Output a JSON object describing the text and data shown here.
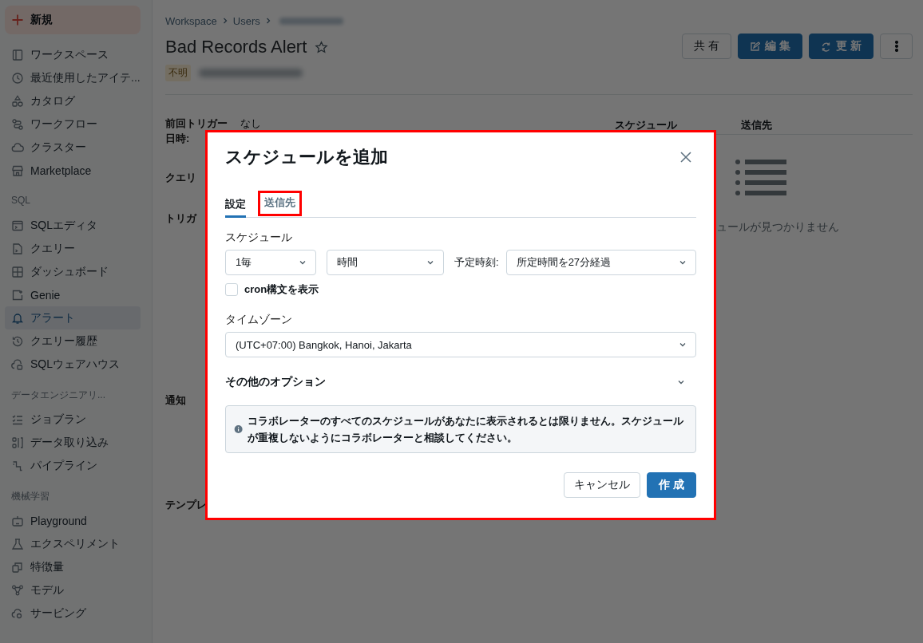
{
  "sidebar": {
    "new_button": {
      "label": "新規"
    },
    "sections": [
      {
        "items": [
          {
            "label": "ワークスペース",
            "selected": false
          },
          {
            "label": "最近使用したアイテ...",
            "selected": false
          },
          {
            "label": "カタログ",
            "selected": false
          },
          {
            "label": "ワークフロー",
            "selected": false
          },
          {
            "label": "クラスター",
            "selected": false
          },
          {
            "label": "Marketplace",
            "selected": false
          }
        ]
      },
      {
        "heading": "SQL",
        "items": [
          {
            "label": "SQLエディタ",
            "selected": false
          },
          {
            "label": "クエリー",
            "selected": false
          },
          {
            "label": "ダッシュボード",
            "selected": false
          },
          {
            "label": "Genie",
            "selected": false
          },
          {
            "label": "アラート",
            "selected": true
          },
          {
            "label": "クエリー履歴",
            "selected": false
          },
          {
            "label": "SQLウェアハウス",
            "selected": false
          }
        ]
      },
      {
        "heading": "データエンジニアリ...",
        "items": [
          {
            "label": "ジョブラン",
            "selected": false
          },
          {
            "label": "データ取り込み",
            "selected": false
          },
          {
            "label": "パイプライン",
            "selected": false
          }
        ]
      },
      {
        "heading": "機械学習",
        "items": [
          {
            "label": "Playground",
            "selected": false
          },
          {
            "label": "エクスペリメント",
            "selected": false
          },
          {
            "label": "特徴量",
            "selected": false
          },
          {
            "label": "モデル",
            "selected": false
          },
          {
            "label": "サービング",
            "selected": false
          }
        ]
      }
    ]
  },
  "page": {
    "breadcrumb": [
      "Workspace",
      "Users"
    ],
    "title": "Bad Records Alert",
    "favorite": false,
    "status_badge": "不明",
    "actions": [
      {
        "label": "共有",
        "kind": "default"
      },
      {
        "label": "編集",
        "kind": "primary"
      },
      {
        "label": "更新",
        "kind": "primary"
      }
    ],
    "last_triggered": {
      "label": "前回トリガー日時:",
      "value": "なし"
    },
    "fields": [
      "クエリ",
      "トリガ",
      "通知",
      "テンプレ"
    ],
    "right_panel": {
      "columns": [
        "スケジュール",
        "送信先"
      ],
      "empty_text": "ュールが見つかりません"
    }
  },
  "dialog": {
    "title": "スケジュールを追加",
    "highlighted": true,
    "tabs": [
      {
        "label": "設定",
        "selected": true,
        "highlighted": false
      },
      {
        "label": "送信先",
        "selected": false,
        "highlighted": true
      }
    ],
    "schedule_label": "スケジュール",
    "interval": "1毎",
    "unit": "時間",
    "time_label": "予定時刻:",
    "time": "所定時間を27分経過",
    "cron_checkbox": {
      "label": "cron構文を表示",
      "checked": false
    },
    "timezone_label": "タイムゾーン",
    "timezone": "(UTC+07:00) Bangkok, Hanoi, Jakarta",
    "more_options": {
      "label": "その他のオプション",
      "expanded": false
    },
    "info": "コラボレーターのすべてのスケジュールがあなたに表示されるとは限りません。スケジュールが重複しないようにコラボレーターと相談してください。",
    "buttons": [
      {
        "label": "キャンセル",
        "kind": "default"
      },
      {
        "label": "作成",
        "kind": "primary"
      }
    ]
  }
}
